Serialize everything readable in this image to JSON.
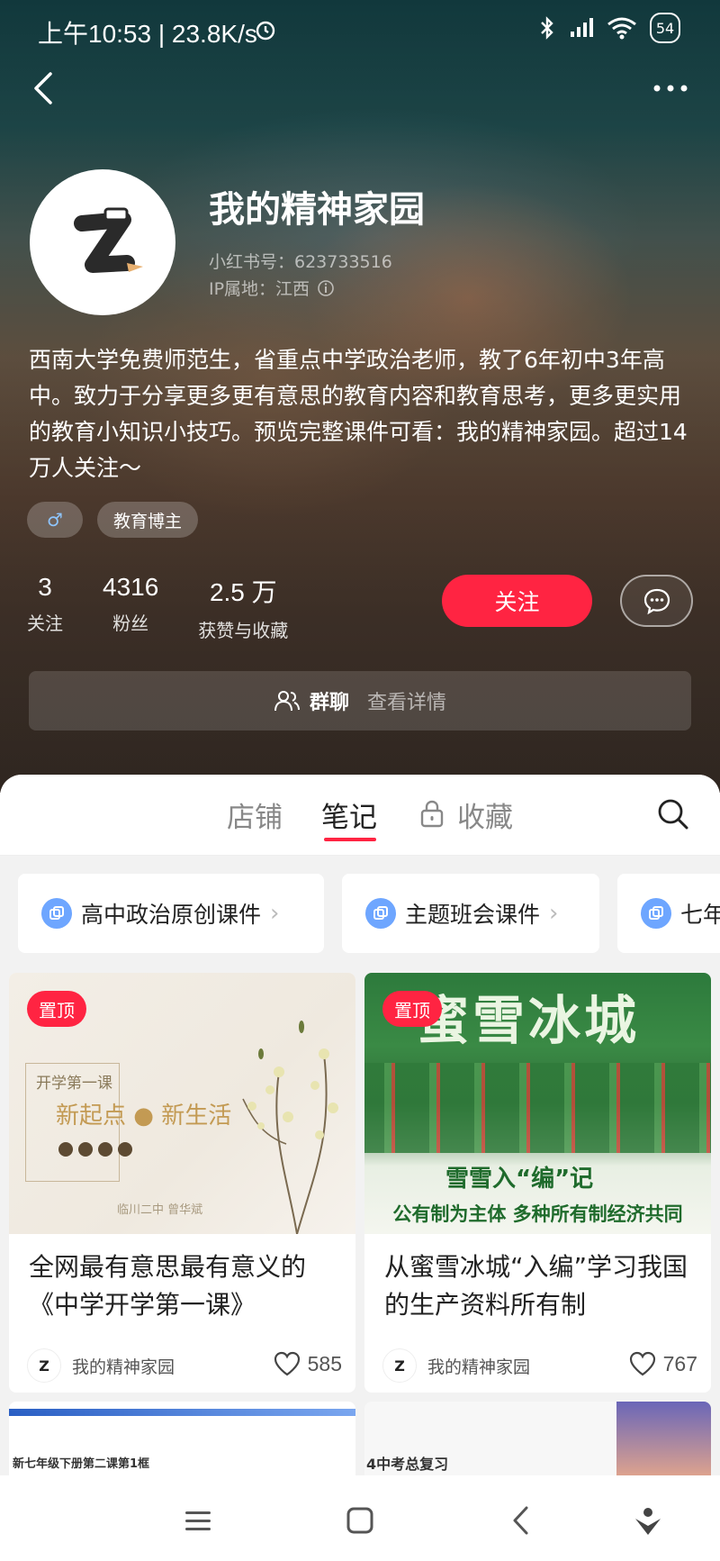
{
  "status_bar": {
    "time": "上午10:53 | 23.8K/s",
    "battery": "54"
  },
  "profile": {
    "name": "我的精神家园",
    "account_id": "小红书号：623733516",
    "ip_location": "IP属地：江西",
    "bio": "西南大学免费师范生，省重点中学政治老师，教了6年初中3年高中。致力于分享更多更有意思的教育内容和教育思考，更多更实用的教育小知识小技巧。预览完整课件可看：我的精神家园。超过14万人关注～",
    "gender_symbol": "♂",
    "tag": "教育博主",
    "stats": [
      {
        "value": "3",
        "label": "关注"
      },
      {
        "value": "4316",
        "label": "粉丝"
      },
      {
        "value": "2.5 万",
        "label": "获赞与收藏"
      }
    ],
    "follow_label": "关注"
  },
  "group_chat": {
    "title": "群聊",
    "detail": "查看详情"
  },
  "tabs": [
    {
      "label": "店铺"
    },
    {
      "label": "笔记"
    },
    {
      "label": "收藏"
    }
  ],
  "collections": [
    {
      "label": "高中政治原创课件"
    },
    {
      "label": "主题班会课件"
    },
    {
      "label": "七年"
    }
  ],
  "notes": [
    {
      "pin": "置顶",
      "title": "全网最有意思最有意义的《中学开学第一课》",
      "author": "我的精神家园",
      "likes": "585",
      "image_text": {
        "line1": "开学第一课",
        "line2": "新起点 ● 新生活",
        "footer": "临川二中 曾华斌"
      }
    },
    {
      "pin": "置顶",
      "title": "从蜜雪冰城“入编”学习我国的生产资料所有制",
      "author": "我的精神家园",
      "likes": "767",
      "image_text": {
        "headline": "蜜雪冰城",
        "sub1": "雪雪入“编”记",
        "sub2": "公有制为主体 多种所有制经济共同"
      }
    }
  ],
  "partial_notes": [
    {
      "text": "新七年级下册第二课第1框"
    },
    {
      "text": "4中考总复习"
    }
  ],
  "colors": {
    "accent": "#ff2442",
    "collection_icon": "#6ea6ff"
  }
}
